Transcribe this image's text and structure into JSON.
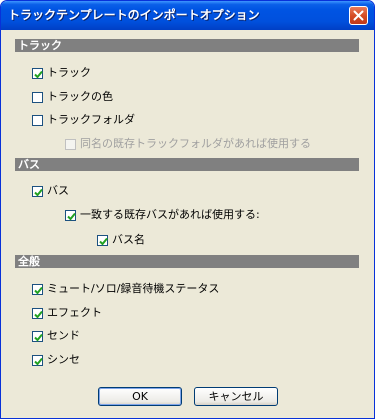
{
  "window": {
    "title": "トラックテンプレートのインポートオプション"
  },
  "sections": {
    "track": "トラック",
    "bus": "バス",
    "general": "全般"
  },
  "options": {
    "track": {
      "label": "トラック",
      "checked": true,
      "disabled": false
    },
    "track_color": {
      "label": "トラックの色",
      "checked": false,
      "disabled": false
    },
    "track_folder": {
      "label": "トラックフォルダ",
      "checked": false,
      "disabled": false
    },
    "use_existing_folder": {
      "label": "同名の既存トラックフォルダがあれば使用する",
      "checked": false,
      "disabled": true
    },
    "bus": {
      "label": "バス",
      "checked": true,
      "disabled": false
    },
    "use_existing_bus": {
      "label": "一致する既存バスがあれば使用する:",
      "checked": true,
      "disabled": false
    },
    "bus_name": {
      "label": "バス名",
      "checked": true,
      "disabled": false
    },
    "mute_solo": {
      "label": "ミュート/ソロ/録音待機ステータス",
      "checked": true,
      "disabled": false
    },
    "effects": {
      "label": "エフェクト",
      "checked": true,
      "disabled": false
    },
    "sends": {
      "label": "センド",
      "checked": true,
      "disabled": false
    },
    "synth": {
      "label": "シンセ",
      "checked": true,
      "disabled": false
    }
  },
  "buttons": {
    "ok": "OK",
    "cancel": "キャンセル"
  },
  "colors": {
    "titlebar": "#0054e3",
    "section_header": "#808080",
    "face": "#ece9d8",
    "check": "#21a121"
  }
}
